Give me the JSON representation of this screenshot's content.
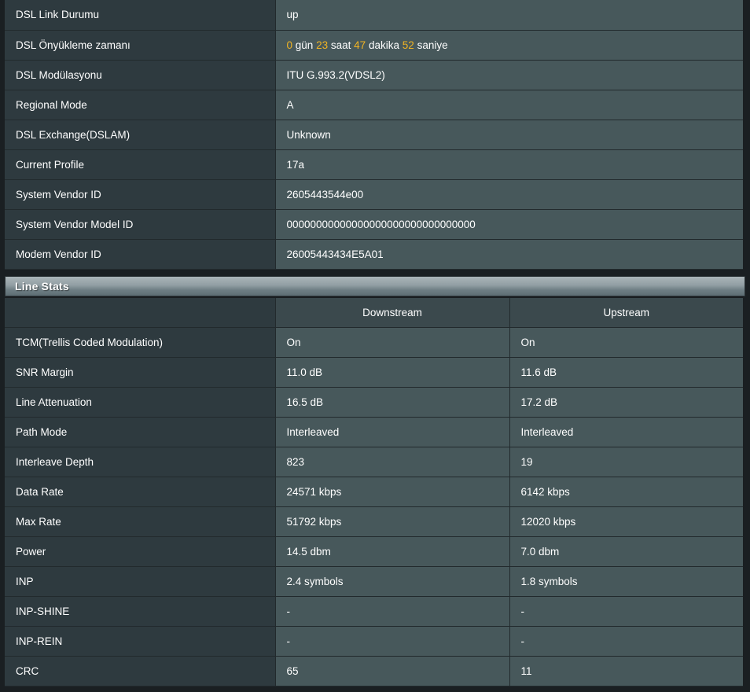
{
  "dsl_info": {
    "rows": [
      {
        "label": "DSL Link Durumu",
        "value": "up"
      },
      {
        "label": "DSL Önyükleme zamanı",
        "value": "",
        "uptime": true
      },
      {
        "label": "DSL Modülasyonu",
        "value": "ITU G.993.2(VDSL2)"
      },
      {
        "label": "Regional Mode",
        "value": "A"
      },
      {
        "label": "DSL Exchange(DSLAM)",
        "value": "Unknown"
      },
      {
        "label": "Current Profile",
        "value": "17a"
      },
      {
        "label": "System Vendor ID",
        "value": "2605443544e00"
      },
      {
        "label": "System Vendor Model ID",
        "value": "00000000000000000000000000000000"
      },
      {
        "label": "Modem Vendor ID",
        "value": "26005443434E5A01"
      }
    ]
  },
  "uptime": {
    "days": "0",
    "days_unit": "gün",
    "hours": "23",
    "hours_unit": "saat",
    "minutes": "47",
    "minutes_unit": "dakika",
    "seconds": "52",
    "seconds_unit": "saniye",
    "highlight_color": "#f0b323"
  },
  "line_stats": {
    "section_title": "Line Stats",
    "headers": {
      "blank": "",
      "downstream": "Downstream",
      "upstream": "Upstream"
    },
    "rows": [
      {
        "label": "TCM(Trellis Coded Modulation)",
        "down": "On",
        "up": "On"
      },
      {
        "label": "SNR Margin",
        "down": "11.0 dB",
        "up": "11.6 dB"
      },
      {
        "label": "Line Attenuation",
        "down": "16.5 dB",
        "up": "17.2 dB"
      },
      {
        "label": "Path Mode",
        "down": "Interleaved",
        "up": "Interleaved"
      },
      {
        "label": "Interleave Depth",
        "down": "823",
        "up": "19"
      },
      {
        "label": "Data Rate",
        "down": "24571 kbps",
        "up": "6142 kbps"
      },
      {
        "label": "Max Rate",
        "down": "51792 kbps",
        "up": "12020 kbps"
      },
      {
        "label": "Power",
        "down": "14.5 dbm",
        "up": "7.0 dbm"
      },
      {
        "label": "INP",
        "down": "2.4 symbols",
        "up": "1.8 symbols"
      },
      {
        "label": "INP-SHINE",
        "down": "-",
        "up": "-"
      },
      {
        "label": "INP-REIN",
        "down": "-",
        "up": "-"
      },
      {
        "label": "CRC",
        "down": "65",
        "up": "11"
      }
    ]
  }
}
